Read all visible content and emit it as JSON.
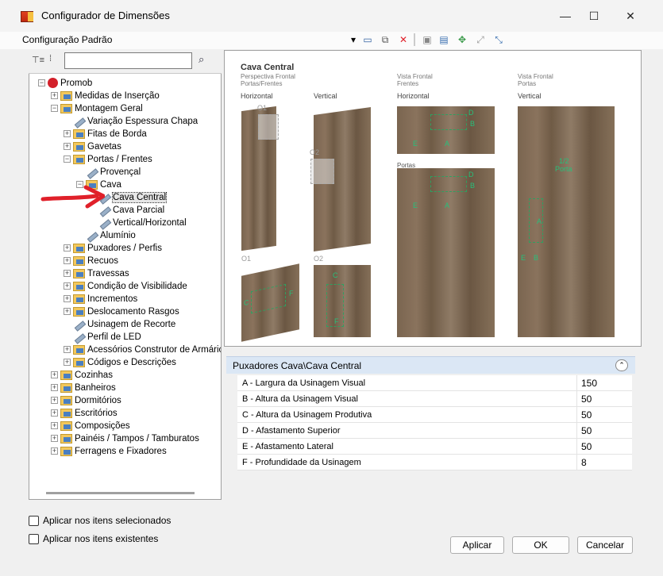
{
  "window": {
    "title": "Configurador de Dimensões",
    "minimize": "—",
    "maximize": "☐",
    "close": "✕"
  },
  "toolbar": {
    "config_name": "Configuração Padrão",
    "icons": [
      "dropdown-arrow",
      "edit-icon",
      "copy-icon",
      "delete-icon",
      "save-icon",
      "save-as-icon",
      "settings-icon",
      "link-icon",
      "unlink-icon"
    ]
  },
  "tree": {
    "tool_icons": [
      "tree-expand-icon",
      "tree-collapse-icon",
      "binoculars-icon"
    ],
    "search_value": "",
    "nodes": [
      {
        "label": "Promob",
        "level": 0,
        "exp": "−",
        "icon": "promob"
      },
      {
        "label": "Medidas de Inserção",
        "level": 1,
        "exp": "+",
        "icon": "folder"
      },
      {
        "label": "Montagem Geral",
        "level": 1,
        "exp": "−",
        "icon": "folder"
      },
      {
        "label": "Variação Espessura Chapa",
        "level": 2,
        "exp": "",
        "icon": "pen"
      },
      {
        "label": "Fitas de Borda",
        "level": 2,
        "exp": "+",
        "icon": "folder"
      },
      {
        "label": "Gavetas",
        "level": 2,
        "exp": "+",
        "icon": "folder"
      },
      {
        "label": "Portas / Frentes",
        "level": 2,
        "exp": "−",
        "icon": "folder"
      },
      {
        "label": "Provençal",
        "level": 3,
        "exp": "",
        "icon": "pen"
      },
      {
        "label": "Cava",
        "level": 3,
        "exp": "−",
        "icon": "folder"
      },
      {
        "label": "Cava Central",
        "level": 4,
        "exp": "",
        "icon": "pen",
        "selected": true
      },
      {
        "label": "Cava Parcial",
        "level": 4,
        "exp": "",
        "icon": "pen"
      },
      {
        "label": "Vertical/Horizontal",
        "level": 4,
        "exp": "",
        "icon": "pen"
      },
      {
        "label": "Alumínio",
        "level": 3,
        "exp": "",
        "icon": "pen"
      },
      {
        "label": "Puxadores / Perfis",
        "level": 2,
        "exp": "+",
        "icon": "folder"
      },
      {
        "label": "Recuos",
        "level": 2,
        "exp": "+",
        "icon": "folder"
      },
      {
        "label": "Travessas",
        "level": 2,
        "exp": "+",
        "icon": "folder"
      },
      {
        "label": "Condição de Visibilidade",
        "level": 2,
        "exp": "+",
        "icon": "folder"
      },
      {
        "label": "Incrementos",
        "level": 2,
        "exp": "+",
        "icon": "folder"
      },
      {
        "label": "Deslocamento Rasgos",
        "level": 2,
        "exp": "+",
        "icon": "folder"
      },
      {
        "label": "Usinagem de Recorte",
        "level": 2,
        "exp": "",
        "icon": "pen"
      },
      {
        "label": "Perfil de LED",
        "level": 2,
        "exp": "",
        "icon": "pen"
      },
      {
        "label": "Acessórios Construtor de Armário",
        "level": 2,
        "exp": "+",
        "icon": "folder"
      },
      {
        "label": "Códigos e Descrições",
        "level": 2,
        "exp": "+",
        "icon": "folder"
      },
      {
        "label": "Cozinhas",
        "level": 1,
        "exp": "+",
        "icon": "folder"
      },
      {
        "label": "Banheiros",
        "level": 1,
        "exp": "+",
        "icon": "folder"
      },
      {
        "label": "Dormitórios",
        "level": 1,
        "exp": "+",
        "icon": "folder"
      },
      {
        "label": "Escritórios",
        "level": 1,
        "exp": "+",
        "icon": "folder"
      },
      {
        "label": "Composições",
        "level": 1,
        "exp": "+",
        "icon": "folder"
      },
      {
        "label": "Painéis / Tampos / Tamburatos",
        "level": 1,
        "exp": "+",
        "icon": "folder"
      },
      {
        "label": "Ferragens e Fixadores",
        "level": 1,
        "exp": "+",
        "icon": "folder"
      }
    ]
  },
  "checks": {
    "selected_items": "Aplicar nos itens selecionados",
    "existing_items": "Aplicar nos itens existentes"
  },
  "preview": {
    "title": "Cava Central",
    "sub1": "Perspectiva Frontal",
    "sub2": "Portas/Frentes",
    "horizontal": "Horizontal",
    "vertical": "Vertical",
    "vf1": "Vista Frontal",
    "vf1b": "Frentes",
    "vf2": "Vista Frontal",
    "vf2b": "Portas",
    "portas": "Portas",
    "o1": "O1",
    "o2": "O2",
    "lbl_a": "A",
    "lbl_b": "B",
    "lbl_c": "C",
    "lbl_d": "D",
    "lbl_e": "E",
    "lbl_f": "F",
    "half": "1/2",
    "porta": "Porta"
  },
  "properties": {
    "header": "Puxadores Cava\\Cava Central",
    "rows": [
      {
        "label": "A - Largura da Usinagem Visual",
        "value": "150"
      },
      {
        "label": "B - Altura da Usinagem Visual",
        "value": "50"
      },
      {
        "label": "C - Altura da Usinagem Produtiva",
        "value": "50"
      },
      {
        "label": "D - Afastamento Superior",
        "value": "50"
      },
      {
        "label": "E - Afastamento Lateral",
        "value": "50"
      },
      {
        "label": "F - Profundidade da Usinagem",
        "value": "8"
      }
    ]
  },
  "buttons": {
    "apply": "Aplicar",
    "ok": "OK",
    "cancel": "Cancelar"
  },
  "colors": {
    "accent_red": "#e0202a",
    "guide_green": "#27c07a",
    "header_blue": "#dbe7f5"
  }
}
